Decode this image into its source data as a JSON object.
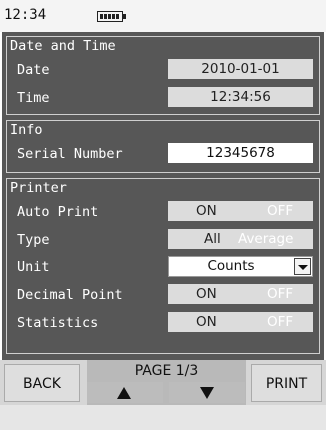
{
  "status": {
    "time": "12:34"
  },
  "sections": {
    "datetime": {
      "title": "Date and Time",
      "date_label": "Date",
      "date_value": "2010-01-01",
      "time_label": "Time",
      "time_value": "12:34:56"
    },
    "info": {
      "title": "Info",
      "serial_label": "Serial Number",
      "serial_value": "12345678"
    },
    "printer": {
      "title": "Printer",
      "auto_print": {
        "label": "Auto Print",
        "on": "ON",
        "off": "OFF"
      },
      "type": {
        "label": "Type",
        "on": "All",
        "off": "Average"
      },
      "unit": {
        "label": "Unit",
        "value": "Counts"
      },
      "decimal_point": {
        "label": "Decimal Point",
        "on": "ON",
        "off": "OFF"
      },
      "statistics": {
        "label": "Statistics",
        "on": "ON",
        "off": "OFF"
      }
    }
  },
  "footer": {
    "back": "BACK",
    "page": "PAGE 1/3",
    "print": "PRINT"
  }
}
